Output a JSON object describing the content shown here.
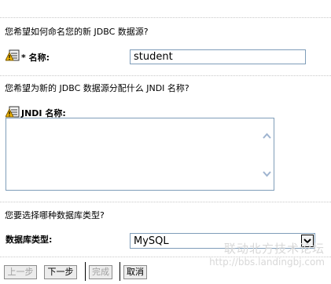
{
  "q1": "您希望如何命名您的新 JDBC 数据源?",
  "name_label": "* 名称:",
  "name_value": "student",
  "q2": "您希望为新的 JDBC 数据源分配什么 JNDI 名称?",
  "jndi_label": "JNDI 名称:",
  "jndi_value": "",
  "q3": "您要选择哪种数据库类型?",
  "db_label": "数据库类型:",
  "db_value": "MySQL",
  "buttons": {
    "back": "上一步",
    "next": "下一步",
    "finish": "完成",
    "cancel": "取消"
  },
  "watermark": {
    "line1": "联动北方技术论坛",
    "line2": "http://bbs.landingbj.com"
  }
}
